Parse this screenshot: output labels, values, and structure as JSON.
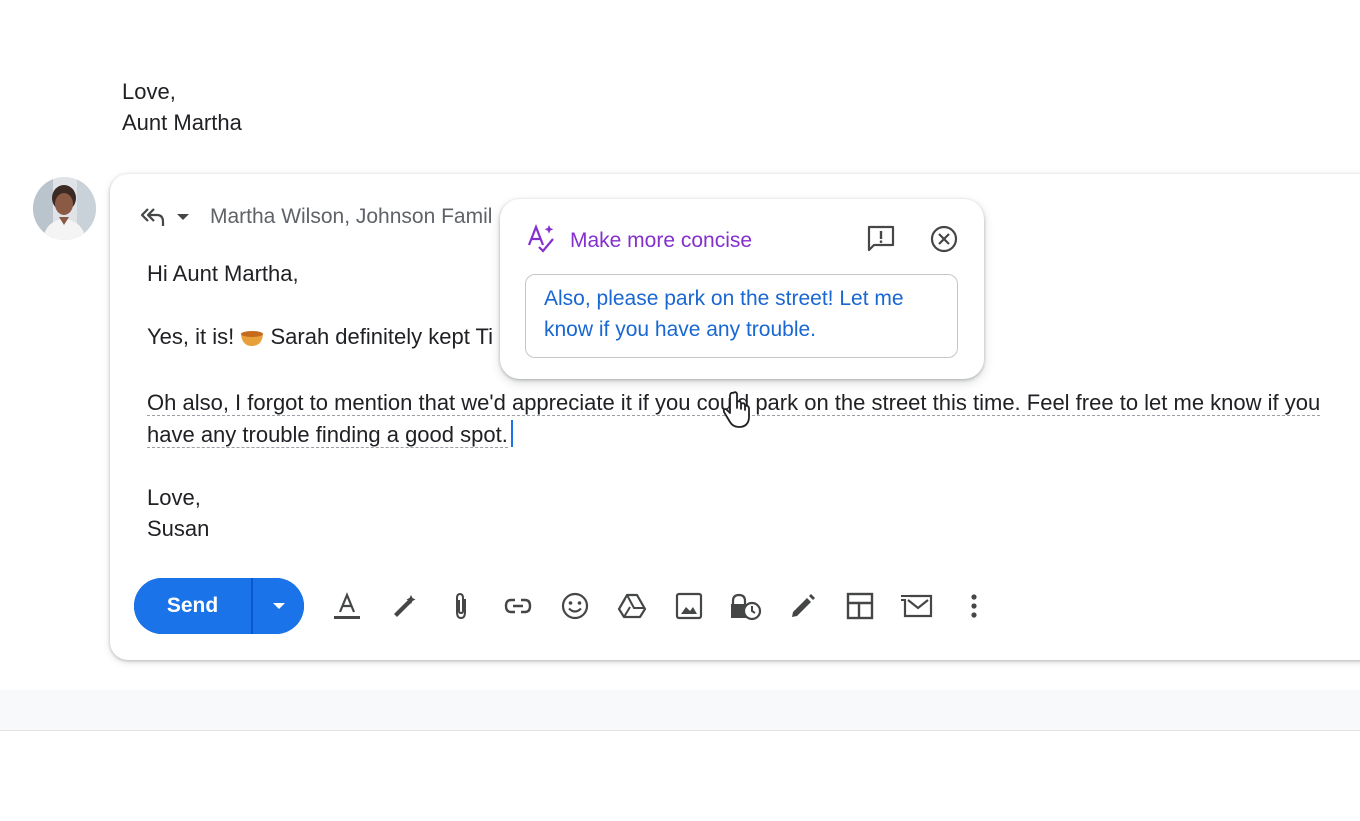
{
  "previous_message": {
    "signoff": "Love,",
    "signature": "Aunt Martha"
  },
  "compose": {
    "recipients": "Martha Wilson, Johnson Famil",
    "body": {
      "greeting": "Hi Aunt Martha,",
      "line1_start": "Yes, it is!",
      "line1_rest": "Sarah definitely kept Ti",
      "paragraph2_line1": "Oh also, I forgot to mention that we'd appreciate it if you could park on the street this time. Feel free to let me know if you",
      "paragraph2_line2": "have any trouble finding a good spot.",
      "signoff": "Love,",
      "signature": "Susan"
    },
    "send_label": "Send",
    "toolbar_icons": [
      "text-format-icon",
      "magic-pen-icon",
      "attach-icon",
      "link-icon",
      "emoji-icon",
      "drive-icon",
      "photo-icon",
      "confidential-icon",
      "signature-icon",
      "layout-icon",
      "template-icon",
      "more-options-icon"
    ]
  },
  "help_me_write": {
    "title": "Make more concise",
    "suggestion": "Also, please park on the street! Let me know if you have any trouble.",
    "accent_color": "#8430ce",
    "suggestion_color": "#1967d2"
  },
  "colors": {
    "send_button": "#1a73e8",
    "text": "#202124",
    "muted": "#5f6368"
  }
}
